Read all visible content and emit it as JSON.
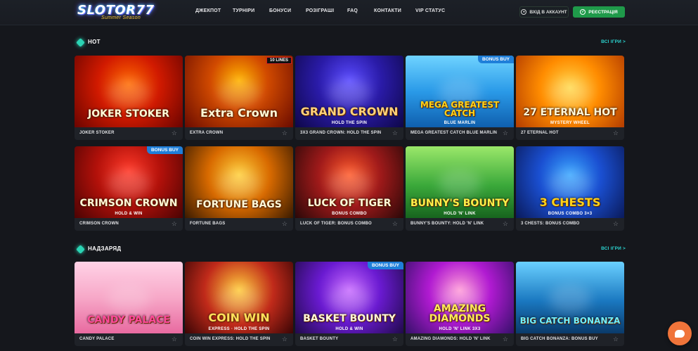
{
  "header": {
    "logo_text": "SLOTOR77",
    "logo_sub": "Summer Season",
    "nav": [
      "ДЖЕКПОТ",
      "ТУРНІРИ",
      "БОНУСИ",
      "РОЗІГРАШІ",
      "FAQ",
      "КОНТАКТИ",
      "VIP СТАТУС"
    ],
    "login_label": "ВХІД В АККАУНТ",
    "register_label": "РЕЄСТРАЦІЯ"
  },
  "sections": [
    {
      "title": "HOT",
      "see_all": "ВСІ ІГРИ >",
      "games": [
        {
          "name": "JOKER STOKER",
          "art": "JOKER STOKER",
          "sub": "",
          "badge": "",
          "bg": "joker"
        },
        {
          "name": "EXTRA CROWN",
          "art": "Extra Crown",
          "sub": "",
          "badge": "10 LINES",
          "bg": "extra"
        },
        {
          "name": "3X3 GRAND CROWN: HOLD THE SPIN",
          "art": "GRAND CROWN",
          "sub": "HOLD THE SPIN",
          "badge": "",
          "bg": "grand"
        },
        {
          "name": "MEGA GREATEST CATCH BLUE MARLIN",
          "art": "MEGA GREATEST CATCH",
          "sub": "BLUE MARLIN",
          "badge": "BONUS BUY",
          "bg": "mega"
        },
        {
          "name": "27 ETERNAL HOT",
          "art": "27 ETERNAL HOT",
          "sub": "MYSTERY WHEEL",
          "badge": "",
          "bg": "eternal"
        }
      ]
    },
    {
      "title": "",
      "see_all": "",
      "games": [
        {
          "name": "CRIMSON CROWN",
          "art": "CRIMSON CROWN",
          "sub": "HOLD & WIN",
          "badge": "BONUS BUY",
          "bg": "crimson"
        },
        {
          "name": "FORTUNE BAGS",
          "art": "FORTUNE BAGS",
          "sub": "",
          "badge": "",
          "bg": "fortune"
        },
        {
          "name": "LUCK OF TIGER: BONUS COMBO",
          "art": "LUCK OF TIGER",
          "sub": "BONUS COMBO",
          "badge": "",
          "bg": "tiger"
        },
        {
          "name": "BUNNY'S BOUNTY: HOLD 'N' LINK",
          "art": "BUNNY'S BOUNTY",
          "sub": "HOLD 'N' LINK",
          "badge": "",
          "bg": "bunny"
        },
        {
          "name": "3 CHESTS: BONUS COMBO",
          "art": "3 CHESTS",
          "sub": "BONUS COMBO 3×3",
          "badge": "",
          "bg": "chests"
        }
      ]
    },
    {
      "title": "НАДЗАРЯД",
      "see_all": "ВСІ ІГРИ >",
      "games": [
        {
          "name": "CANDY PALACE",
          "art": "CANDY PALACE",
          "sub": "",
          "badge": "",
          "bg": "candy"
        },
        {
          "name": "COIN WIN EXPRESS: HOLD THE SPIN",
          "art": "COIN WIN",
          "sub": "EXPRESS · HOLD THE SPIN",
          "badge": "",
          "bg": "coin"
        },
        {
          "name": "BASKET BOUNTY",
          "art": "BASKET BOUNTY",
          "sub": "HOLD & WIN",
          "badge": "BONUS BUY",
          "bg": "basket"
        },
        {
          "name": "AMAZING DIAMONDS: HOLD 'N' LINK",
          "art": "AMAZING DIAMONDS",
          "sub": "HOLD 'N' LINK 3X3",
          "badge": "",
          "bg": "diamonds"
        },
        {
          "name": "BIG CATCH BONANZA: BONUS BUY",
          "art": "BIG CATCH BONANZA",
          "sub": "",
          "badge": "",
          "bg": "bigcatch"
        }
      ]
    }
  ],
  "colors": {
    "accent": "#2bd4d0",
    "register": "#1f9a4a",
    "badge": "#1f7fd9",
    "chat": "#f0743a"
  },
  "icons": {
    "favorite": "star-outline-icon",
    "section": "diamond-icon",
    "chat": "chat-icon"
  }
}
